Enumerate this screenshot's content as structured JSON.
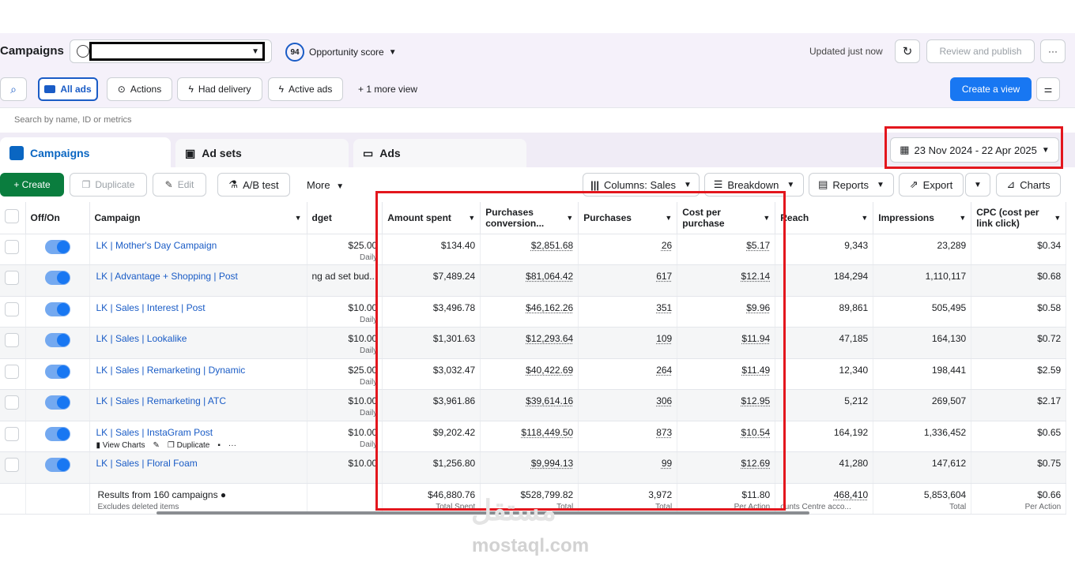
{
  "header": {
    "title": "Campaigns",
    "account_value": "",
    "score_value": "94",
    "score_label": "Opportunity score",
    "updated": "Updated just now",
    "review_publish": "Review and publish",
    "more": "···"
  },
  "views": {
    "all_ads": "All ads",
    "actions": "Actions",
    "had_delivery": "Had delivery",
    "active_ads": "Active ads",
    "more_view": "+ 1 more view",
    "create_view": "Create a view"
  },
  "search": {
    "placeholder": "Search by name, ID or metrics"
  },
  "tabs": {
    "campaigns": "Campaigns",
    "ad_sets": "Ad sets",
    "ads": "Ads"
  },
  "date_range": "23 Nov 2024 - 22 Apr 2025",
  "actions_bar": {
    "create": "+ Create",
    "duplicate": "Duplicate",
    "edit": "Edit",
    "ab_test": "A/B test",
    "more": "More",
    "columns": "Columns: Sales",
    "breakdown": "Breakdown",
    "reports": "Reports",
    "export": "Export",
    "charts": "Charts"
  },
  "columns": {
    "offon": "Off/On",
    "campaign": "Campaign",
    "budget": "dget",
    "amount_spent": "Amount spent",
    "purchases_conv_1": "Purchases",
    "purchases_conv_2": "conversion...",
    "purchases": "Purchases",
    "cost_per_1": "Cost per",
    "cost_per_2": "purchase",
    "reach": "Reach",
    "impressions": "Impressions",
    "cpc_1": "CPC (cost per",
    "cpc_2": "link click)"
  },
  "rows": [
    {
      "name": "LK | Mother's Day Campaign",
      "budget": "$25.00",
      "budget_sub": "Daily",
      "amount": "$134.40",
      "conv": "$2,851.68",
      "purchases": "26",
      "cost": "$5.17",
      "reach": "9,343",
      "impressions": "23,289",
      "cpc": "$0.34"
    },
    {
      "name": "LK | Advantage + Shopping | Post",
      "budget": "ng ad set bud...",
      "budget_sub": "",
      "amount": "$7,489.24",
      "conv": "$81,064.42",
      "purchases": "617",
      "cost": "$12.14",
      "reach": "184,294",
      "impressions": "1,110,117",
      "cpc": "$0.68"
    },
    {
      "name": "LK | Sales | Interest | Post",
      "budget": "$10.00",
      "budget_sub": "Daily",
      "amount": "$3,496.78",
      "conv": "$46,162.26",
      "purchases": "351",
      "cost": "$9.96",
      "reach": "89,861",
      "impressions": "505,495",
      "cpc": "$0.58"
    },
    {
      "name": "LK | Sales | Lookalike",
      "budget": "$10.00",
      "budget_sub": "Daily",
      "amount": "$1,301.63",
      "conv": "$12,293.64",
      "purchases": "109",
      "cost": "$11.94",
      "reach": "47,185",
      "impressions": "164,130",
      "cpc": "$0.72"
    },
    {
      "name": "LK | Sales | Remarketing | Dynamic",
      "budget": "$25.00",
      "budget_sub": "Daily",
      "amount": "$3,032.47",
      "conv": "$40,422.69",
      "purchases": "264",
      "cost": "$11.49",
      "reach": "12,340",
      "impressions": "198,441",
      "cpc": "$2.59"
    },
    {
      "name": "LK | Sales | Remarketing | ATC",
      "budget": "$10.00",
      "budget_sub": "Daily",
      "amount": "$3,961.86",
      "conv": "$39,614.16",
      "purchases": "306",
      "cost": "$12.95",
      "reach": "5,212",
      "impressions": "269,507",
      "cpc": "$2.17"
    },
    {
      "name": "LK | Sales | InstaGram Post",
      "budget": "$10.00",
      "budget_sub": "Daily",
      "amount": "$9,202.42",
      "conv": "$118,449.50",
      "purchases": "873",
      "cost": "$10.54",
      "reach": "164,192",
      "impressions": "1,336,452",
      "cpc": "$0.65"
    },
    {
      "name": "LK | Sales | Floral Foam",
      "budget": "$10.00",
      "budget_sub": "",
      "amount": "$1,256.80",
      "conv": "$9,994.13",
      "purchases": "99",
      "cost": "$12.69",
      "reach": "41,280",
      "impressions": "147,612",
      "cpc": "$0.75"
    }
  ],
  "row_actions": {
    "view_charts": "View Charts",
    "duplicate": "Duplicate",
    "more": "···"
  },
  "totals": {
    "label": "Results from 160 campaigns",
    "sub": "Excludes deleted items",
    "amount": "$46,880.76",
    "amount_sub": "Total Spent",
    "conv": "$528,799.82",
    "conv_sub": "Total",
    "purchases": "3,972",
    "purchases_sub": "Total",
    "cost": "$11.80",
    "cost_sub": "Per Action",
    "reach": "468,410",
    "reach_sub": "ounts Centre acco...",
    "impressions": "5,853,604",
    "impressions_sub": "Total",
    "cpc": "$0.66",
    "cpc_sub": "Per Action"
  },
  "watermark": {
    "arabic": "مستقل",
    "latin": "mostaql.com"
  },
  "colors": {
    "primary": "#1877f2",
    "create": "#0a7d3e",
    "highlight": "#e3161d",
    "link": "#1a5cc6"
  }
}
